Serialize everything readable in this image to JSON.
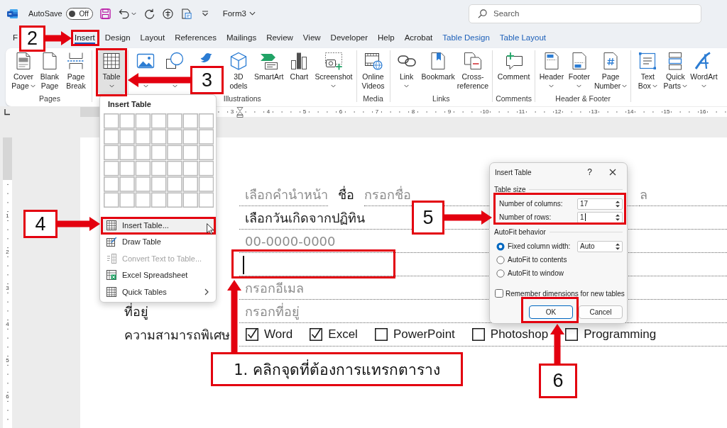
{
  "title_bar": {
    "autosave_label": "AutoSave",
    "autosave": {
      "on": false,
      "label": "Off"
    },
    "document_name": "Form3",
    "search": {
      "placeholder": "Search"
    }
  },
  "tabs": [
    {
      "label": "F",
      "kind": "normal",
      "selected": false
    },
    {
      "label": "Insert",
      "kind": "normal",
      "selected": true
    },
    {
      "label": "Design",
      "kind": "normal",
      "selected": false
    },
    {
      "label": "Layout",
      "kind": "normal",
      "selected": false
    },
    {
      "label": "References",
      "kind": "normal",
      "selected": false
    },
    {
      "label": "Mailings",
      "kind": "normal",
      "selected": false
    },
    {
      "label": "Review",
      "kind": "normal",
      "selected": false
    },
    {
      "label": "View",
      "kind": "normal",
      "selected": false
    },
    {
      "label": "Developer",
      "kind": "normal",
      "selected": false
    },
    {
      "label": "Help",
      "kind": "normal",
      "selected": false
    },
    {
      "label": "Acrobat",
      "kind": "normal",
      "selected": false
    },
    {
      "label": "Table Design",
      "kind": "contextual",
      "selected": false
    },
    {
      "label": "Table Layout",
      "kind": "contextual",
      "selected": false
    }
  ],
  "ribbon": {
    "groups": [
      {
        "label": "Pages",
        "buttons": [
          {
            "lines": [
              "Cover",
              "Page"
            ],
            "has_menu": true,
            "pressed": false
          },
          {
            "lines": [
              "Blank",
              "Page"
            ],
            "has_menu": false,
            "pressed": false
          },
          {
            "lines": [
              "Page",
              "Break"
            ],
            "has_menu": false,
            "pressed": false
          }
        ]
      },
      {
        "buttons": [
          {
            "lines": [
              "Table"
            ],
            "has_menu": true,
            "pressed": true
          }
        ]
      },
      {
        "label": "Illustrations",
        "buttons": [
          {
            "has_menu": true,
            "pressed": false
          },
          {
            "has_menu": true,
            "pressed": false
          },
          {
            "has_menu": false,
            "pressed": false
          },
          {
            "lines": [
              "3D",
              "odels"
            ],
            "has_menu": false,
            "pressed": false
          },
          {
            "lines": [
              "SmartArt"
            ],
            "has_menu": false,
            "pressed": false
          },
          {
            "lines": [
              "Chart"
            ],
            "has_menu": false,
            "pressed": false
          },
          {
            "lines": [
              "Screenshot"
            ],
            "has_menu": true,
            "pressed": false
          }
        ]
      },
      {
        "label": "Media",
        "buttons": [
          {
            "lines": [
              "Online",
              "Videos"
            ],
            "has_menu": false,
            "pressed": false
          }
        ]
      },
      {
        "label": "Links",
        "buttons": [
          {
            "lines": [
              "Link"
            ],
            "has_menu": true,
            "pressed": false
          },
          {
            "lines": [
              "Bookmark"
            ],
            "has_menu": false,
            "pressed": false
          },
          {
            "lines": [
              "Cross-",
              "reference"
            ],
            "has_menu": false,
            "pressed": false
          }
        ]
      },
      {
        "label": "Comments",
        "buttons": [
          {
            "lines": [
              "Comment"
            ],
            "has_menu": false,
            "pressed": false
          }
        ]
      },
      {
        "label": "Header & Footer",
        "buttons": [
          {
            "lines": [
              "Header"
            ],
            "has_menu": true,
            "pressed": false
          },
          {
            "lines": [
              "Footer"
            ],
            "has_menu": true,
            "pressed": false
          },
          {
            "lines": [
              "Page",
              "Number"
            ],
            "has_menu": true,
            "pressed": false
          }
        ]
      },
      {
        "buttons": [
          {
            "lines": [
              "Text",
              "Box"
            ],
            "has_menu": true,
            "pressed": false
          },
          {
            "lines": [
              "Quick",
              "Parts"
            ],
            "has_menu": true,
            "pressed": false
          },
          {
            "lines": [
              "WordArt"
            ],
            "has_menu": true,
            "pressed": false
          }
        ]
      }
    ]
  },
  "ruler": {
    "numbers": [
      "3",
      "4",
      "5",
      "6",
      "7",
      "8",
      "9",
      "10",
      "11",
      "12",
      "13",
      "14",
      "15",
      "16"
    ]
  },
  "vertical_ruler": {
    "numbers": [
      "1",
      "2",
      "3",
      "4",
      "5",
      "6"
    ]
  },
  "document": {
    "rows": [
      {
        "caret": false,
        "items": [
          {
            "kind": "placeholder",
            "text": "เลือกคำนำหน้า"
          },
          {
            "kind": "label",
            "text": "ชื่อ"
          },
          {
            "kind": "placeholder",
            "text": "กรอกชื่อ"
          },
          {
            "kind": "placeholder",
            "text": "ล"
          }
        ]
      },
      {
        "caret": false,
        "items": [
          {
            "kind": "value",
            "text": "เลือกวันเกิดจากปฏิทิน"
          }
        ]
      },
      {
        "caret": false,
        "items": [
          {
            "kind": "placeholder",
            "text": "00-0000-0000"
          }
        ]
      },
      {
        "caret": true
      },
      {
        "caret": false,
        "items": [
          {
            "kind": "placeholder",
            "text": "กรอกอีเมล"
          }
        ]
      },
      {
        "label": "ที่อยู่",
        "caret": false,
        "items": [
          {
            "kind": "placeholder",
            "text": "กรอกที่อยู่"
          }
        ]
      },
      {
        "label": "ความสามารถพิเศษ",
        "caret": false,
        "items": [
          {
            "kind": "checkbox",
            "text": "Word",
            "checked": true
          },
          {
            "kind": "checkbox",
            "text": "Excel",
            "checked": true
          },
          {
            "kind": "checkbox",
            "text": "PowerPoint",
            "checked": false
          },
          {
            "kind": "checkbox",
            "text": "Photoshop",
            "checked": false
          },
          {
            "kind": "checkbox",
            "text": "Programming",
            "checked": false
          }
        ]
      }
    ]
  },
  "table_menu": {
    "title": "Insert Table",
    "items": [
      {
        "label": "Insert Table...",
        "highlighted": true,
        "disabled": false,
        "submenu": false
      },
      {
        "label": "Draw Table",
        "highlighted": false,
        "disabled": false,
        "submenu": false
      },
      {
        "label": "Convert Text to Table...",
        "highlighted": false,
        "disabled": true,
        "submenu": false
      },
      {
        "label": "Excel Spreadsheet",
        "highlighted": false,
        "disabled": false,
        "submenu": false
      },
      {
        "label": "Quick Tables",
        "highlighted": false,
        "disabled": false,
        "submenu": true
      }
    ]
  },
  "dialog": {
    "title": "Insert Table",
    "help": "?",
    "table_size": {
      "label": "Table size",
      "fields": [
        {
          "label": "Number of columns:",
          "value": "17",
          "focused": false
        },
        {
          "label": "Number of rows:",
          "value": "1",
          "focused": true
        }
      ]
    },
    "autofit": {
      "label": "AutoFit behavior",
      "options": [
        {
          "label": "Fixed column width:",
          "value": "Auto",
          "selected": true
        },
        {
          "label": "AutoFit to contents",
          "selected": false
        },
        {
          "label": "AutoFit to window",
          "selected": false
        }
      ]
    },
    "remember": {
      "label": "Remember dimensions for new tables",
      "checked": false
    },
    "buttons": [
      {
        "label": "OK",
        "default": true
      },
      {
        "label": "Cancel",
        "default": false
      }
    ]
  },
  "annotations": [
    {
      "kind": "step",
      "text": "2"
    },
    {
      "kind": "step",
      "text": "3"
    },
    {
      "kind": "step",
      "text": "4"
    },
    {
      "kind": "step",
      "text": "5"
    },
    {
      "kind": "caption",
      "text": "1. คลิกจุดที่ต้องการแทรกตาราง"
    },
    {
      "kind": "step",
      "text": "6"
    }
  ]
}
